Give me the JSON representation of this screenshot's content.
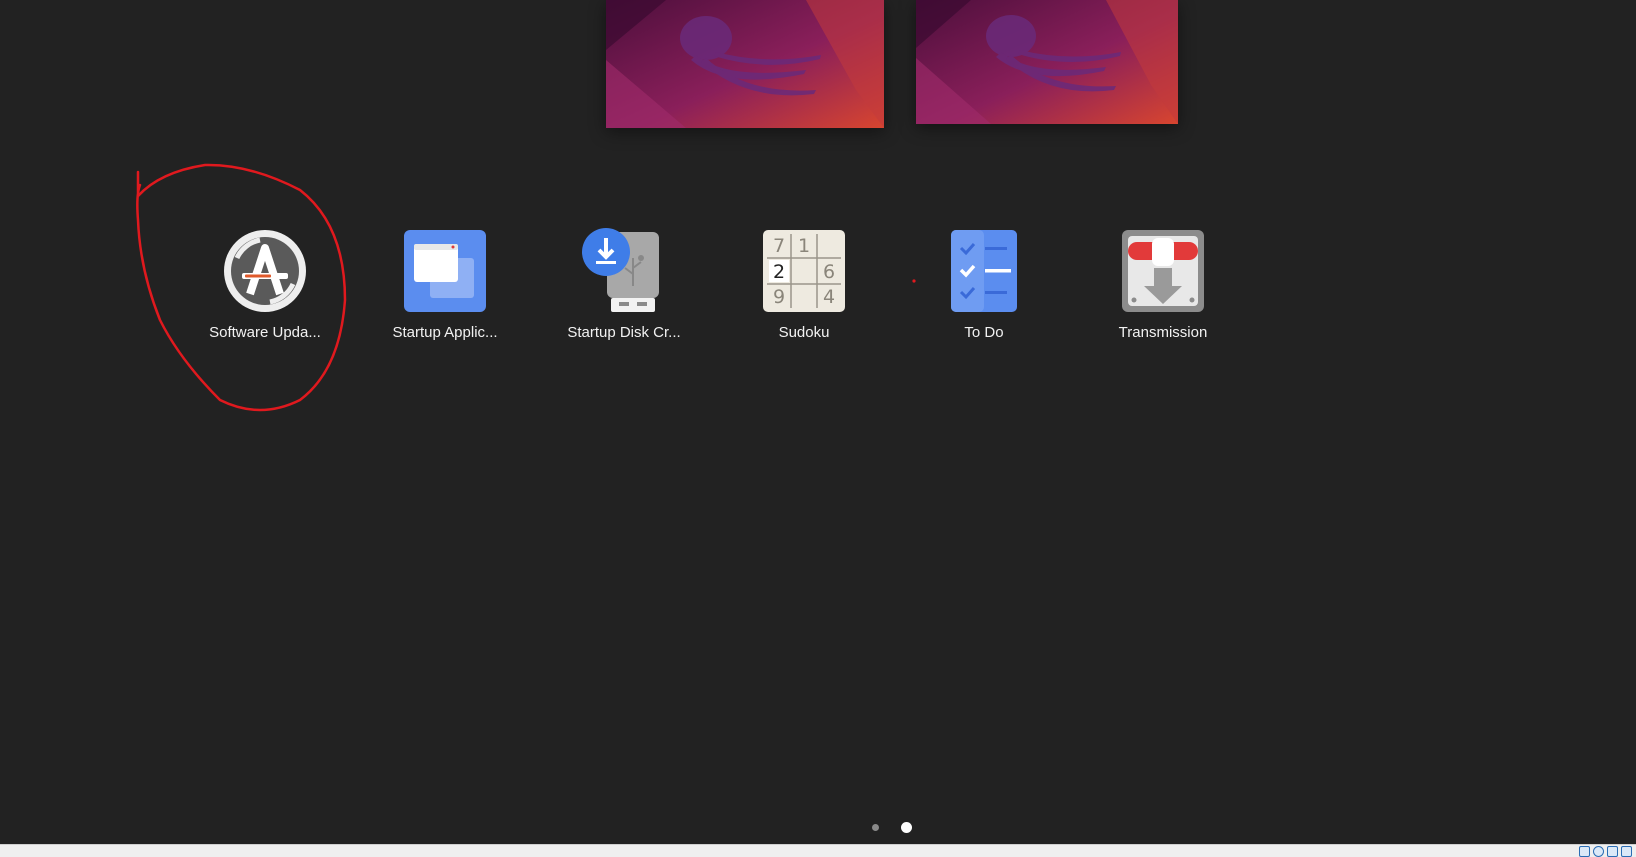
{
  "workspaces": [
    {
      "name": "workspace-1"
    },
    {
      "name": "workspace-2"
    }
  ],
  "apps": [
    {
      "label": "Software Upda...",
      "icon": "software-updater-icon"
    },
    {
      "label": "Startup Applic...",
      "icon": "startup-applications-icon"
    },
    {
      "label": "Startup Disk Cr...",
      "icon": "startup-disk-creator-icon"
    },
    {
      "label": "Sudoku",
      "icon": "sudoku-icon"
    },
    {
      "label": "To Do",
      "icon": "todo-icon"
    },
    {
      "label": "Transmission",
      "icon": "transmission-icon"
    }
  ],
  "sudoku_digits": {
    "r1c1": "7",
    "r1c2": "1",
    "r2c1": "2",
    "r2c3": "6",
    "r3c1": "9",
    "r3c3": "4"
  },
  "pagination": {
    "current": 2,
    "total": 2
  },
  "colors": {
    "background": "#222222",
    "annotation": "#e0191e",
    "accent_blue": "#5b8def"
  }
}
